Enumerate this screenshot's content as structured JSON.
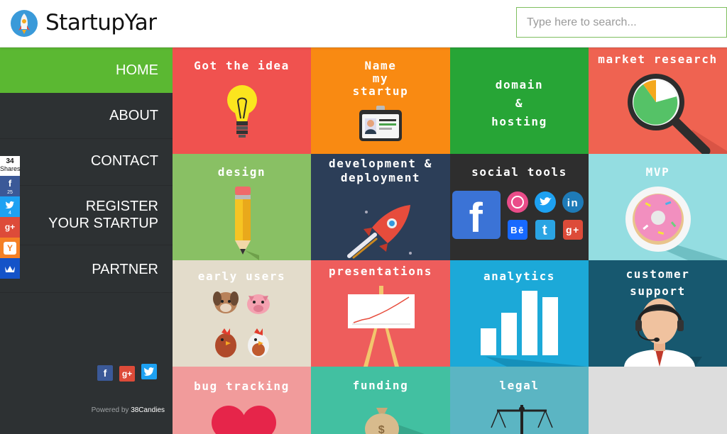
{
  "header": {
    "brand": "StartupYar",
    "search_placeholder": "Type here to search..."
  },
  "sidebar": {
    "items": [
      {
        "label": "HOME",
        "active": true
      },
      {
        "label": "ABOUT"
      },
      {
        "label": "CONTACT"
      },
      {
        "label": "REGISTER YOUR STARTUP"
      },
      {
        "label": "PARTNER"
      }
    ],
    "powered_prefix": "Powered by",
    "powered_brand": "38Candies"
  },
  "share_bar": {
    "total": "34",
    "total_label": "Shares",
    "facebook_count": "25",
    "twitter_count": "4"
  },
  "tiles": [
    {
      "title": "Got the idea",
      "color": "#f0524f",
      "icon": "lightbulb-icon"
    },
    {
      "title": "Name\nmy\nstartup",
      "color": "#f98a12",
      "icon": "id-badge-icon"
    },
    {
      "title": "domain\n&\nhosting",
      "color": "#27a536",
      "icon": ""
    },
    {
      "title": "market research",
      "color": "#ef6351",
      "icon": "magnifier-chart-icon"
    },
    {
      "title": "design",
      "color": "#89c064",
      "icon": "pencil-icon"
    },
    {
      "title": "development &\ndeployment",
      "color": "#2c3e58",
      "icon": "rocket-icon"
    },
    {
      "title": "social tools",
      "color": "#2e2e2e",
      "icon": "social-icons"
    },
    {
      "title": "MVP",
      "color": "#94dde1",
      "icon": "donut-icon"
    },
    {
      "title": "early users",
      "color": "#e3dccb",
      "icon": "animals-icon"
    },
    {
      "title": "presentations",
      "color": "#ee5d5c",
      "icon": "easel-chart-icon"
    },
    {
      "title": "analytics",
      "color": "#1ca9d8",
      "icon": "bar-chart-icon"
    },
    {
      "title": "customer\nsupport",
      "color": "#17586f",
      "icon": "support-agent-icon"
    },
    {
      "title": "bug tracking",
      "color": "#f19b9b",
      "icon": "heart-icon"
    },
    {
      "title": "funding",
      "color": "#42c0a1",
      "icon": "money-bag-icon"
    },
    {
      "title": "legal",
      "color": "#5bb5c3",
      "icon": "scales-icon"
    },
    {
      "title": "",
      "color": "#dddddd",
      "icon": ""
    }
  ],
  "colors": {
    "accent_green": "#5bb832",
    "sidebar_bg": "#2d3133",
    "facebook": "#3b5998",
    "twitter": "#1da1f2",
    "google_plus": "#dd4b39",
    "yummly": "#f58025"
  }
}
